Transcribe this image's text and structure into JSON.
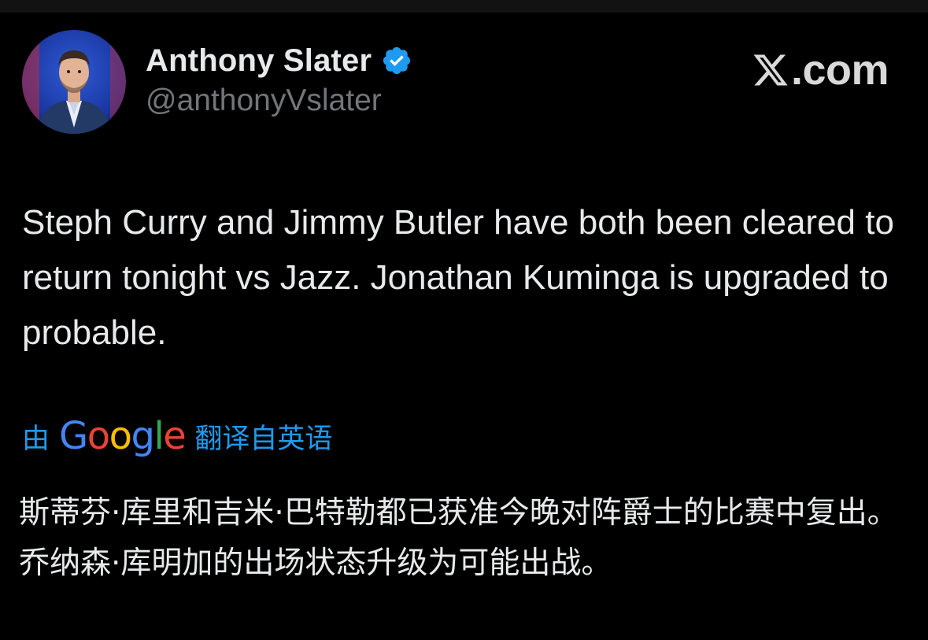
{
  "author": {
    "name": "Anthony Slater",
    "handle": "@anthonyVslater",
    "verified_color": "#1d9bf0"
  },
  "brand": {
    "domain": ".com",
    "icon": "x-logo-icon"
  },
  "tweet": {
    "text": "Steph Curry and Jimmy Butler have both been cleared to return tonight vs Jazz. Jonathan Kuminga is upgraded to probable."
  },
  "translation": {
    "by_label": "由",
    "provider": {
      "letters": [
        "G",
        "o",
        "o",
        "g",
        "l",
        "e"
      ]
    },
    "label": "翻译自英语",
    "text": "斯蒂芬·库里和吉米·巴特勒都已获准今晚对阵爵士的比赛中复出。乔纳森·库明加的出场状态升级为可能出战。"
  },
  "colors": {
    "background": "#000000",
    "text": "#e7e9ea",
    "secondary": "#71767b",
    "accent": "#1d9bf0"
  }
}
